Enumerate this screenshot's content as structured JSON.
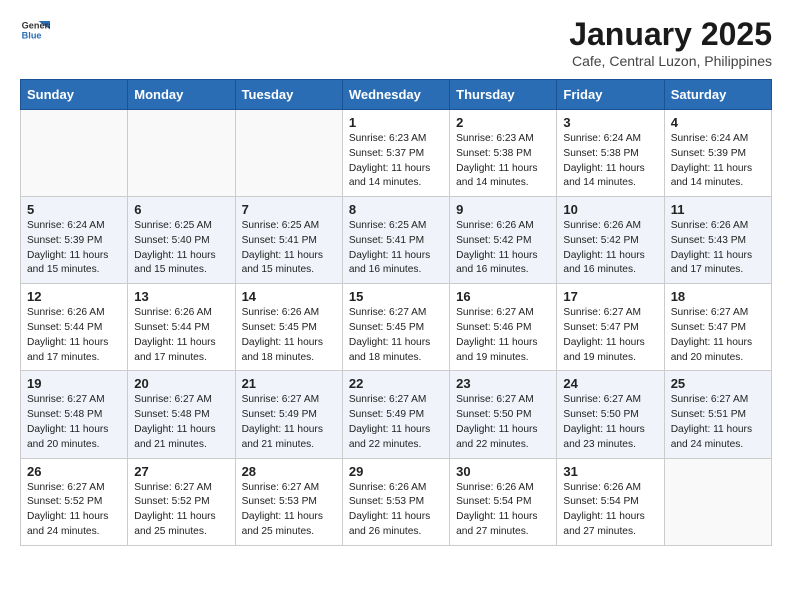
{
  "header": {
    "logo_general": "General",
    "logo_blue": "Blue",
    "main_title": "January 2025",
    "subtitle": "Cafe, Central Luzon, Philippines"
  },
  "days_of_week": [
    "Sunday",
    "Monday",
    "Tuesday",
    "Wednesday",
    "Thursday",
    "Friday",
    "Saturday"
  ],
  "weeks": [
    [
      {
        "day": "",
        "sunrise": "",
        "sunset": "",
        "daylight": ""
      },
      {
        "day": "",
        "sunrise": "",
        "sunset": "",
        "daylight": ""
      },
      {
        "day": "",
        "sunrise": "",
        "sunset": "",
        "daylight": ""
      },
      {
        "day": "1",
        "sunrise": "Sunrise: 6:23 AM",
        "sunset": "Sunset: 5:37 PM",
        "daylight": "Daylight: 11 hours and 14 minutes."
      },
      {
        "day": "2",
        "sunrise": "Sunrise: 6:23 AM",
        "sunset": "Sunset: 5:38 PM",
        "daylight": "Daylight: 11 hours and 14 minutes."
      },
      {
        "day": "3",
        "sunrise": "Sunrise: 6:24 AM",
        "sunset": "Sunset: 5:38 PM",
        "daylight": "Daylight: 11 hours and 14 minutes."
      },
      {
        "day": "4",
        "sunrise": "Sunrise: 6:24 AM",
        "sunset": "Sunset: 5:39 PM",
        "daylight": "Daylight: 11 hours and 14 minutes."
      }
    ],
    [
      {
        "day": "5",
        "sunrise": "Sunrise: 6:24 AM",
        "sunset": "Sunset: 5:39 PM",
        "daylight": "Daylight: 11 hours and 15 minutes."
      },
      {
        "day": "6",
        "sunrise": "Sunrise: 6:25 AM",
        "sunset": "Sunset: 5:40 PM",
        "daylight": "Daylight: 11 hours and 15 minutes."
      },
      {
        "day": "7",
        "sunrise": "Sunrise: 6:25 AM",
        "sunset": "Sunset: 5:41 PM",
        "daylight": "Daylight: 11 hours and 15 minutes."
      },
      {
        "day": "8",
        "sunrise": "Sunrise: 6:25 AM",
        "sunset": "Sunset: 5:41 PM",
        "daylight": "Daylight: 11 hours and 16 minutes."
      },
      {
        "day": "9",
        "sunrise": "Sunrise: 6:26 AM",
        "sunset": "Sunset: 5:42 PM",
        "daylight": "Daylight: 11 hours and 16 minutes."
      },
      {
        "day": "10",
        "sunrise": "Sunrise: 6:26 AM",
        "sunset": "Sunset: 5:42 PM",
        "daylight": "Daylight: 11 hours and 16 minutes."
      },
      {
        "day": "11",
        "sunrise": "Sunrise: 6:26 AM",
        "sunset": "Sunset: 5:43 PM",
        "daylight": "Daylight: 11 hours and 17 minutes."
      }
    ],
    [
      {
        "day": "12",
        "sunrise": "Sunrise: 6:26 AM",
        "sunset": "Sunset: 5:44 PM",
        "daylight": "Daylight: 11 hours and 17 minutes."
      },
      {
        "day": "13",
        "sunrise": "Sunrise: 6:26 AM",
        "sunset": "Sunset: 5:44 PM",
        "daylight": "Daylight: 11 hours and 17 minutes."
      },
      {
        "day": "14",
        "sunrise": "Sunrise: 6:26 AM",
        "sunset": "Sunset: 5:45 PM",
        "daylight": "Daylight: 11 hours and 18 minutes."
      },
      {
        "day": "15",
        "sunrise": "Sunrise: 6:27 AM",
        "sunset": "Sunset: 5:45 PM",
        "daylight": "Daylight: 11 hours and 18 minutes."
      },
      {
        "day": "16",
        "sunrise": "Sunrise: 6:27 AM",
        "sunset": "Sunset: 5:46 PM",
        "daylight": "Daylight: 11 hours and 19 minutes."
      },
      {
        "day": "17",
        "sunrise": "Sunrise: 6:27 AM",
        "sunset": "Sunset: 5:47 PM",
        "daylight": "Daylight: 11 hours and 19 minutes."
      },
      {
        "day": "18",
        "sunrise": "Sunrise: 6:27 AM",
        "sunset": "Sunset: 5:47 PM",
        "daylight": "Daylight: 11 hours and 20 minutes."
      }
    ],
    [
      {
        "day": "19",
        "sunrise": "Sunrise: 6:27 AM",
        "sunset": "Sunset: 5:48 PM",
        "daylight": "Daylight: 11 hours and 20 minutes."
      },
      {
        "day": "20",
        "sunrise": "Sunrise: 6:27 AM",
        "sunset": "Sunset: 5:48 PM",
        "daylight": "Daylight: 11 hours and 21 minutes."
      },
      {
        "day": "21",
        "sunrise": "Sunrise: 6:27 AM",
        "sunset": "Sunset: 5:49 PM",
        "daylight": "Daylight: 11 hours and 21 minutes."
      },
      {
        "day": "22",
        "sunrise": "Sunrise: 6:27 AM",
        "sunset": "Sunset: 5:49 PM",
        "daylight": "Daylight: 11 hours and 22 minutes."
      },
      {
        "day": "23",
        "sunrise": "Sunrise: 6:27 AM",
        "sunset": "Sunset: 5:50 PM",
        "daylight": "Daylight: 11 hours and 22 minutes."
      },
      {
        "day": "24",
        "sunrise": "Sunrise: 6:27 AM",
        "sunset": "Sunset: 5:50 PM",
        "daylight": "Daylight: 11 hours and 23 minutes."
      },
      {
        "day": "25",
        "sunrise": "Sunrise: 6:27 AM",
        "sunset": "Sunset: 5:51 PM",
        "daylight": "Daylight: 11 hours and 24 minutes."
      }
    ],
    [
      {
        "day": "26",
        "sunrise": "Sunrise: 6:27 AM",
        "sunset": "Sunset: 5:52 PM",
        "daylight": "Daylight: 11 hours and 24 minutes."
      },
      {
        "day": "27",
        "sunrise": "Sunrise: 6:27 AM",
        "sunset": "Sunset: 5:52 PM",
        "daylight": "Daylight: 11 hours and 25 minutes."
      },
      {
        "day": "28",
        "sunrise": "Sunrise: 6:27 AM",
        "sunset": "Sunset: 5:53 PM",
        "daylight": "Daylight: 11 hours and 25 minutes."
      },
      {
        "day": "29",
        "sunrise": "Sunrise: 6:26 AM",
        "sunset": "Sunset: 5:53 PM",
        "daylight": "Daylight: 11 hours and 26 minutes."
      },
      {
        "day": "30",
        "sunrise": "Sunrise: 6:26 AM",
        "sunset": "Sunset: 5:54 PM",
        "daylight": "Daylight: 11 hours and 27 minutes."
      },
      {
        "day": "31",
        "sunrise": "Sunrise: 6:26 AM",
        "sunset": "Sunset: 5:54 PM",
        "daylight": "Daylight: 11 hours and 27 minutes."
      },
      {
        "day": "",
        "sunrise": "",
        "sunset": "",
        "daylight": ""
      }
    ]
  ]
}
